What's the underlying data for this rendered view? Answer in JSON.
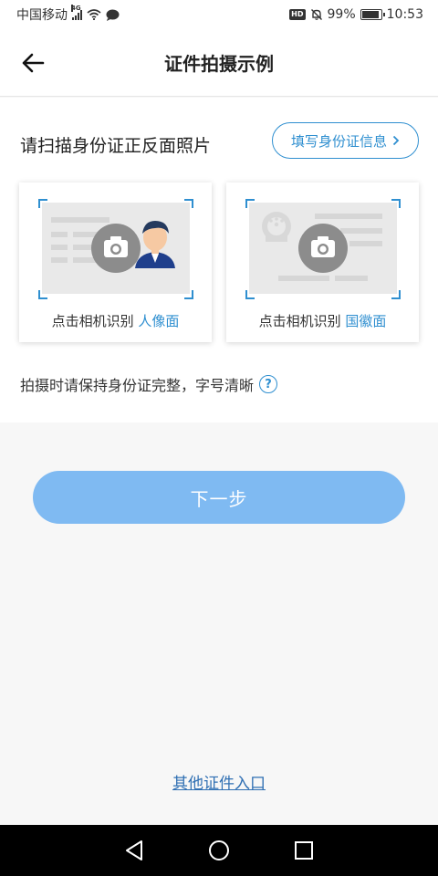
{
  "status_bar": {
    "carrier": "中国移动",
    "network": "4G",
    "hd_badge": "HD",
    "battery": "99%",
    "battery_level": 0.99,
    "time": "10:53"
  },
  "header": {
    "title": "证件拍摄示例",
    "back_icon": "arrow-left-icon"
  },
  "main": {
    "scan_title": "请扫描身份证正反面照片",
    "fill_button_label": "填写身份证信息",
    "cards": [
      {
        "caption_prefix": "点击相机识别 ",
        "caption_highlight": "人像面",
        "icon": "camera-icon"
      },
      {
        "caption_prefix": "点击相机识别 ",
        "caption_highlight": "国徽面",
        "icon": "camera-icon"
      }
    ],
    "tip": "拍摄时请保持身份证完整，字号清晰",
    "tip_help": "?"
  },
  "next_button_label": "下一步",
  "other_link": "其他证件入口",
  "colors": {
    "accent": "#2f8fd0",
    "next_button": "#7fbaf2",
    "link": "#2f6fb3"
  }
}
